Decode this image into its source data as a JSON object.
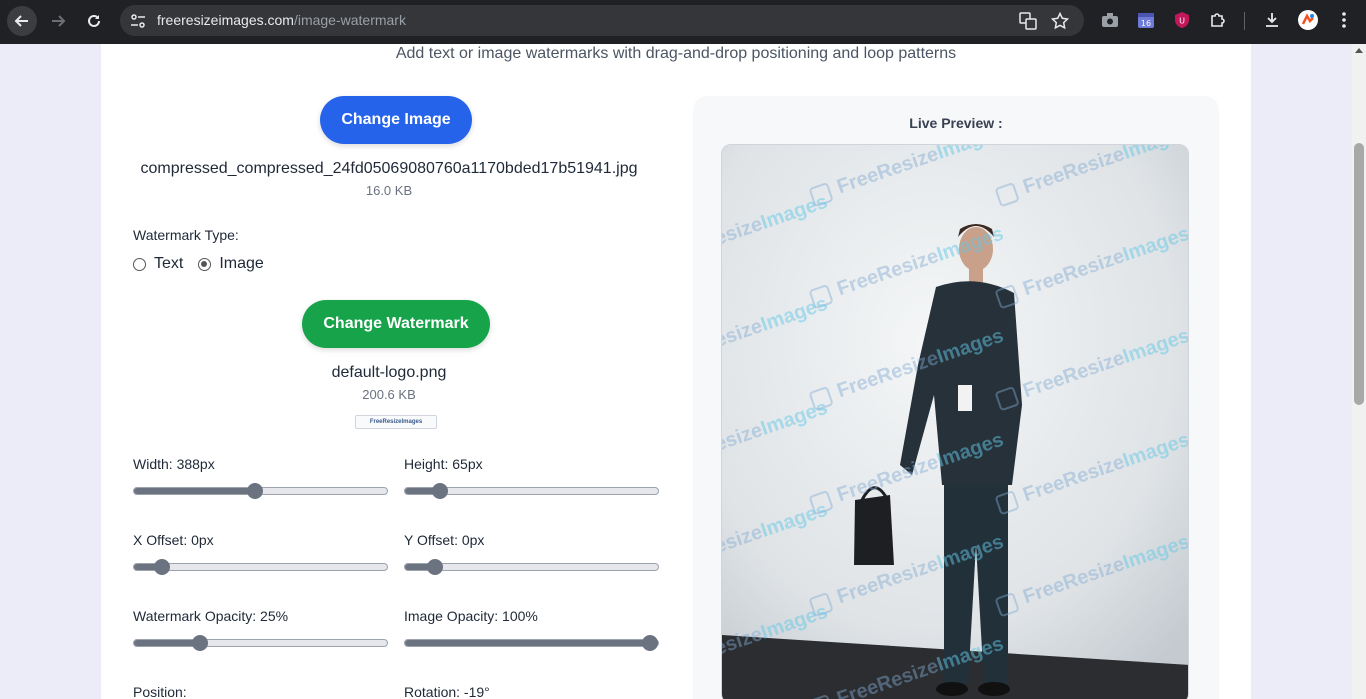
{
  "browser": {
    "url_domain": "freeresizeimages.com",
    "url_path": "/image-watermark"
  },
  "page": {
    "subtitle": "Add text or image watermarks with drag-and-drop positioning and loop patterns"
  },
  "image": {
    "change_button": "Change Image",
    "filename": "compressed_compressed_24fd05069080760a1170bded17b51941.jpg",
    "filesize": "16.0 KB"
  },
  "watermark_type": {
    "label": "Watermark Type:",
    "options": [
      "Text",
      "Image"
    ],
    "selected": "Image"
  },
  "watermark": {
    "change_button": "Change Watermark",
    "filename": "default-logo.png",
    "filesize": "200.6 KB",
    "logo_text": "FreeResizeImages"
  },
  "controls": {
    "width": {
      "label": "Width: 388px",
      "fraction": 0.48
    },
    "height": {
      "label": "Height: 65px",
      "fraction": 0.14
    },
    "x_offset": {
      "label": "X Offset: 0px",
      "fraction": 0.11
    },
    "y_offset": {
      "label": "Y Offset: 0px",
      "fraction": 0.12
    },
    "watermark_opacity": {
      "label": "Watermark Opacity: 25%",
      "fraction": 0.26
    },
    "image_opacity": {
      "label": "Image Opacity: 100%",
      "fraction": 0.97
    },
    "position": {
      "label": "Position:"
    },
    "rotation": {
      "label": "Rotation: -19°"
    }
  },
  "preview": {
    "title": "Live Preview :",
    "watermark_text_1": "FreeResize",
    "watermark_text_2": "Images"
  }
}
